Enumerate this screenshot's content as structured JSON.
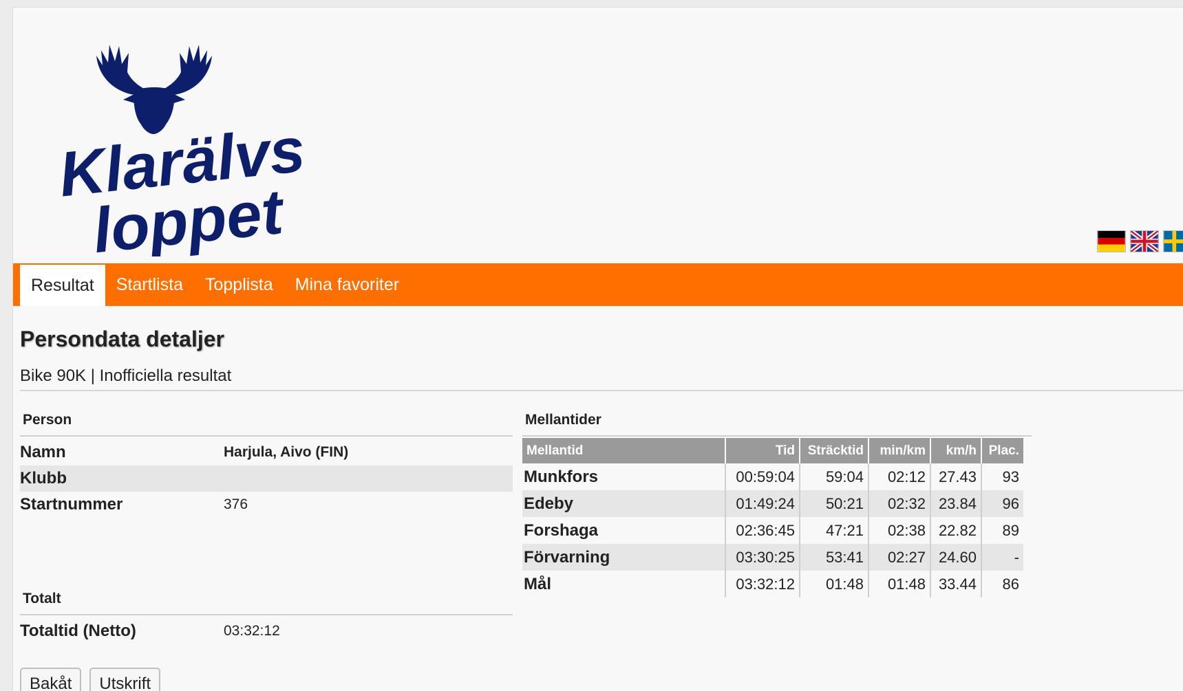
{
  "header": {
    "logo_line1": "Klarälvs",
    "logo_line2": "loppet",
    "logo_icon": "moose-icon",
    "flags": [
      {
        "name": "german-flag-icon"
      },
      {
        "name": "uk-flag-icon"
      },
      {
        "name": "swedish-flag-icon"
      }
    ]
  },
  "nav": {
    "items": [
      {
        "label": "Resultat",
        "active": true
      },
      {
        "label": "Startlista",
        "active": false
      },
      {
        "label": "Topplista",
        "active": false
      },
      {
        "label": "Mina favoriter",
        "active": false
      }
    ]
  },
  "page": {
    "title": "Persondata detaljer",
    "subtitle": "Bike 90K | Inofficiella resultat"
  },
  "person": {
    "heading": "Person",
    "rows": [
      {
        "label": "Namn",
        "value": "Harjula, Aivo (FIN)"
      },
      {
        "label": "Klubb",
        "value": ""
      },
      {
        "label": "Startnummer",
        "value": "376"
      }
    ]
  },
  "total": {
    "heading": "Totalt",
    "rows": [
      {
        "label": "Totaltid (Netto)",
        "value": "03:32:12"
      }
    ]
  },
  "splits": {
    "heading": "Mellantider",
    "columns": [
      "Mellantid",
      "Tid",
      "Sträcktid",
      "min/km",
      "km/h",
      "Plac."
    ],
    "rows": [
      [
        "Munkfors",
        "00:59:04",
        "59:04",
        "02:12",
        "27.43",
        "93"
      ],
      [
        "Edeby",
        "01:49:24",
        "50:21",
        "02:32",
        "23.84",
        "96"
      ],
      [
        "Forshaga",
        "02:36:45",
        "47:21",
        "02:38",
        "22.82",
        "89"
      ],
      [
        "Förvarning",
        "03:30:25",
        "53:41",
        "02:27",
        "24.60",
        "-"
      ],
      [
        "Mål",
        "03:32:12",
        "01:48",
        "01:48",
        "33.44",
        "86"
      ]
    ]
  },
  "buttons": {
    "back": "Bakåt",
    "print": "Utskrift"
  },
  "colors": {
    "nav_bg": "#ff6f00",
    "logo_blue": "#0d1f6b",
    "table_header_bg": "#9a9a9a",
    "row_shade": "#e6e6e6"
  }
}
